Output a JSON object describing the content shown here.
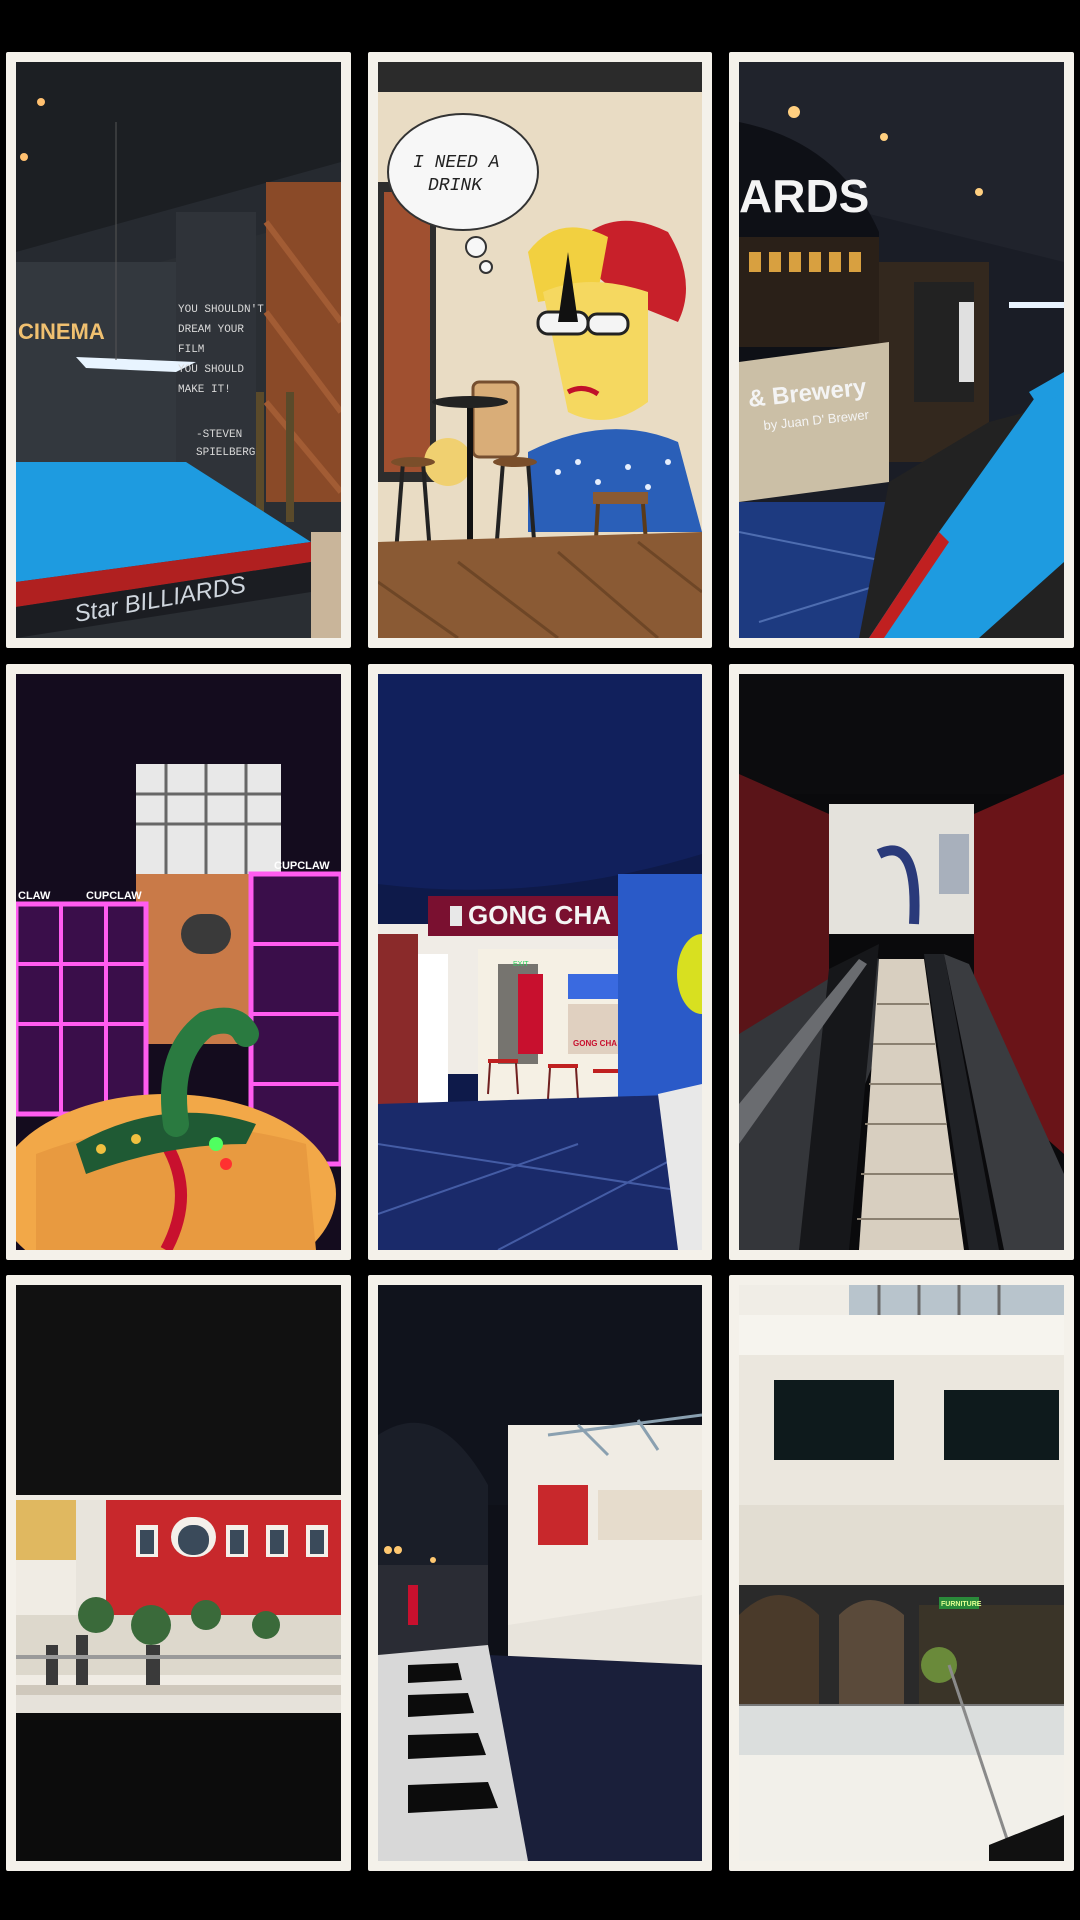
{
  "photos": [
    {
      "label": "billiards-cinema",
      "signs": {
        "cinema": "CINEMA",
        "quote": [
          "YOU SHOULDN'T",
          "DREAM YOUR",
          "FILM",
          "YOU SHOULD",
          "MAKE IT!"
        ],
        "author": [
          "-STEVEN",
          "SPIELBERG"
        ],
        "table_brand": "Star BILLIARDS"
      }
    },
    {
      "label": "popart-mural",
      "signs": {
        "speech_bubble": [
          "I NEED A",
          "DRINK"
        ]
      }
    },
    {
      "label": "billiards-brewery",
      "signs": {
        "top": "ARDS",
        "counter": "& Brewery",
        "counter_sub": "by Juan D' Brewer"
      }
    },
    {
      "label": "claw-machine-arcade",
      "signs": {
        "claw_left": "CLAW",
        "claw_mid": "CUPCLAW",
        "claw_right": "CUPCLAW"
      }
    },
    {
      "label": "gong-cha-store",
      "signs": {
        "store": "GONG CHA",
        "exit": "EXIT",
        "counter": "GONG CHA"
      }
    },
    {
      "label": "escalator",
      "signs": {}
    },
    {
      "label": "atrium-red-facade",
      "signs": {}
    },
    {
      "label": "dark-corridor",
      "signs": {}
    },
    {
      "label": "white-atrium",
      "signs": {
        "store": "FURNITURE"
      }
    }
  ],
  "colors": {
    "frame": "#f4f1ea",
    "background": "#000000",
    "pool_blue": "#1e9be0",
    "arcade_pink": "#e040c8",
    "gongcha_red": "#c8102e"
  }
}
